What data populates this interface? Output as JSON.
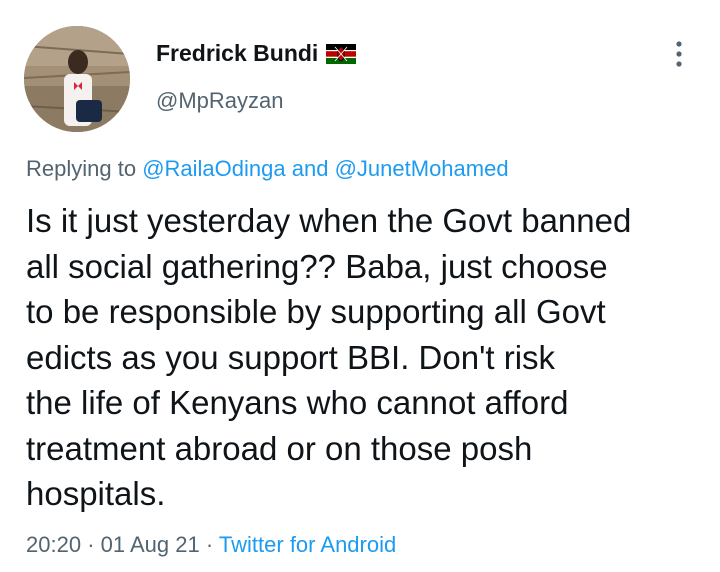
{
  "author": {
    "name": "Fredrick Bundi",
    "flag_icon": "kenya-flag-icon",
    "handle": "@MpRayzan"
  },
  "menu": {
    "icon": "more-vertical-icon"
  },
  "reply": {
    "prefix": "Replying to",
    "mention_1": "@RailaOdinga",
    "conjunction": "and",
    "mention_2": "@JunetMohamed"
  },
  "tweet": {
    "lines": [
      "Is it just yesterday when the Govt banned",
      "all social gathering?? Baba, just choose",
      "to be responsible by supporting all Govt",
      "edicts as you support BBI. Don't risk",
      "the life of Kenyans who cannot afford",
      "treatment abroad or on those posh",
      "hospitals."
    ]
  },
  "meta": {
    "time": "20:20",
    "separator": "·",
    "date": "01 Aug 21",
    "source": "Twitter for Android"
  },
  "colors": {
    "link": "#1d9bf0",
    "secondary": "#536471",
    "text": "#0f1419"
  }
}
